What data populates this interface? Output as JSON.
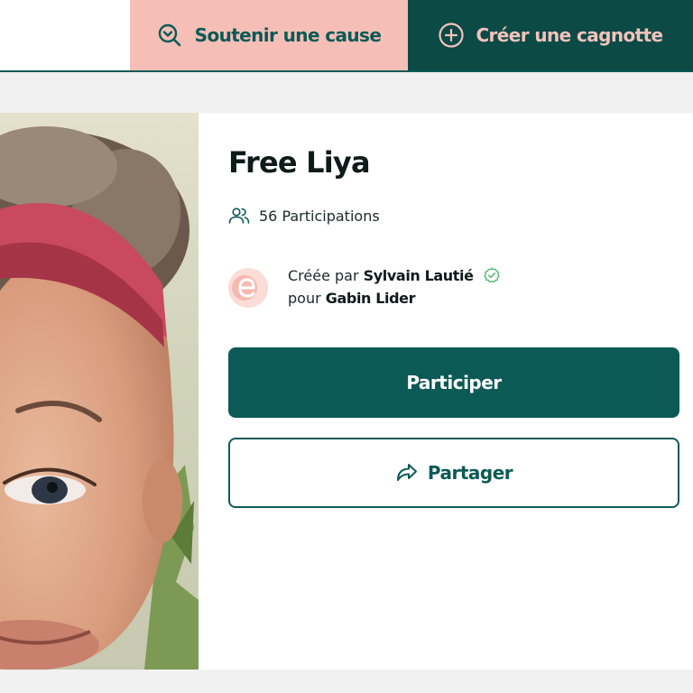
{
  "header": {
    "support_label": "Soutenir une cause",
    "support_icon": "search-heart-icon",
    "create_label": "Créer une cagnotte",
    "create_icon": "plus-circle-icon"
  },
  "campaign": {
    "photo": "child-portrait-photo",
    "title": "Free Liya",
    "participations": "56 Participations",
    "participations_icon": "users-icon",
    "created_prefix": "Créée par",
    "creator_name": "Sylvain Lautié",
    "creator_verified_icon": "verified-check-icon",
    "for_prefix": "pour",
    "beneficiary_name": "Gabin Lider"
  },
  "actions": {
    "participate_label": "Participer",
    "share_label": "Partager",
    "share_icon": "share-arrow-icon"
  },
  "colors": {
    "primary": "#0c5a56",
    "dark": "#0c4a45",
    "pink": "#f5bfb8"
  }
}
